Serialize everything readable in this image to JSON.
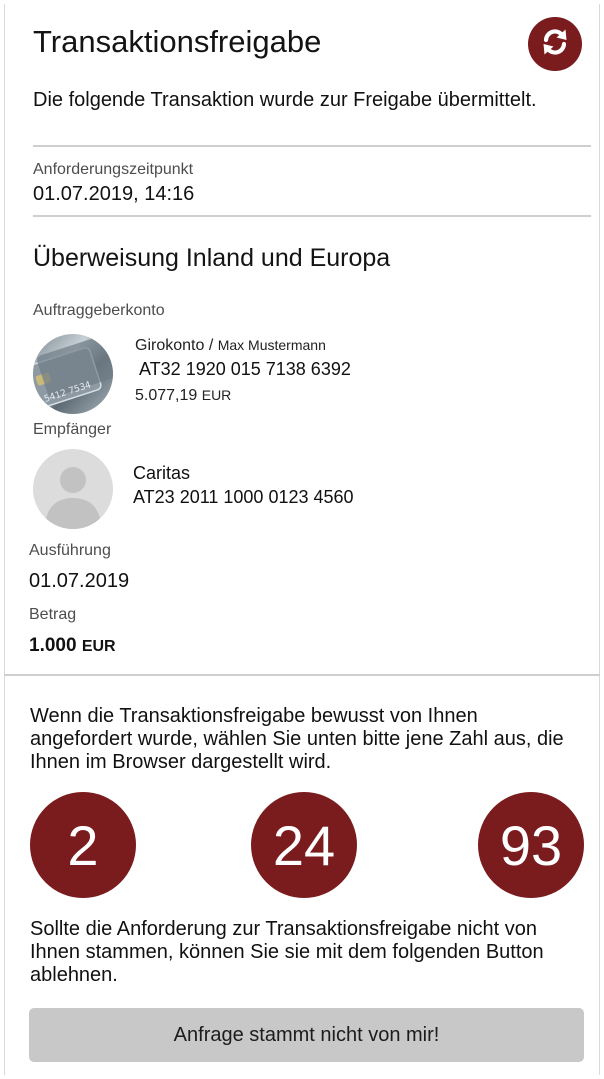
{
  "header": {
    "title": "Transaktionsfreigabe",
    "refresh_icon": "refresh-icon"
  },
  "intro": "Die folgende Transaktion wurde zur Freigabe übermittelt.",
  "request_time": {
    "label": "Anforderungszeitpunkt",
    "value": "01.07.2019, 14:16"
  },
  "transfer_type": "Überweisung Inland und Europa",
  "sender": {
    "label": "Auftraggeberkonto",
    "account_type": "Girokonto",
    "owner": "Max Mustermann",
    "separator": " / ",
    "iban": "AT32 1920 015 7138 6392",
    "balance_amount": "5.077,19",
    "balance_currency": "EUR",
    "avatar_icon": "credit-card-icon"
  },
  "recipient": {
    "label": "Empfänger",
    "name": "Caritas",
    "iban": "AT23 2011 1000 0123 4560",
    "avatar_icon": "person-icon"
  },
  "execution": {
    "label": "Ausführung",
    "value": "01.07.2019"
  },
  "amount": {
    "label": "Betrag",
    "value": "1.000",
    "currency": "EUR"
  },
  "instruction": "Wenn die Transaktionsfreigabe bewusst von Ihnen angefordert wurde, wählen Sie unten bitte jene Zahl aus, die Ihnen im Browser dargestellt wird.",
  "numbers": [
    "2",
    "24",
    "93"
  ],
  "reject_info": "Sollte die Anforderung zur Transaktionsfreigabe nicht von Ihnen stammen, können Sie sie mit dem folgenden Button ablehnen.",
  "reject_button": "Anfrage stammt nicht von mir!",
  "colors": {
    "accent": "#7a1b1e",
    "button_gray": "#c8c8c8",
    "divider": "#cfcfcf"
  }
}
